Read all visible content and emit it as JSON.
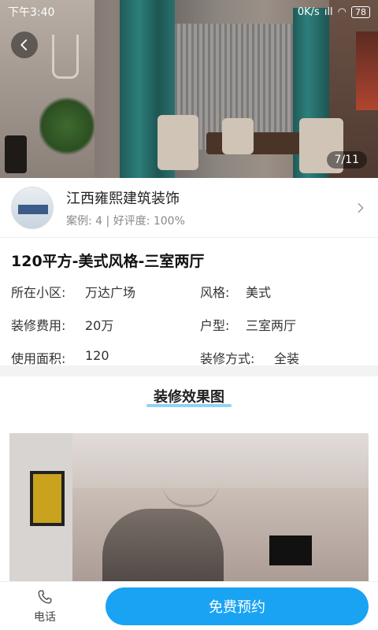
{
  "status_bar": {
    "time": "下午3:40",
    "network": "0K/s",
    "signal": "ıll",
    "battery": "78"
  },
  "gallery": {
    "page_indicator": "7/11"
  },
  "company": {
    "name": "江西雍熙建筑装饰",
    "stats": "案例: 4 | 好评度: 100%"
  },
  "case": {
    "title": "120平方-美式风格-三室两厅",
    "fields": [
      {
        "label": "所在小区:",
        "value": "万达广场"
      },
      {
        "label": "风格:",
        "value": "美式"
      },
      {
        "label": "装修费用:",
        "value": "20万"
      },
      {
        "label": "户型:",
        "value": "三室两厅"
      },
      {
        "label": "使用面积:",
        "value": "120"
      },
      {
        "label": "装修方式:",
        "value": "全装"
      }
    ]
  },
  "section": {
    "title": "装修效果图"
  },
  "bottom_bar": {
    "phone_label": "电话",
    "book_button": "免费预约"
  },
  "colors": {
    "accent": "#1aa3f2",
    "underline": "#8fd3f4"
  }
}
